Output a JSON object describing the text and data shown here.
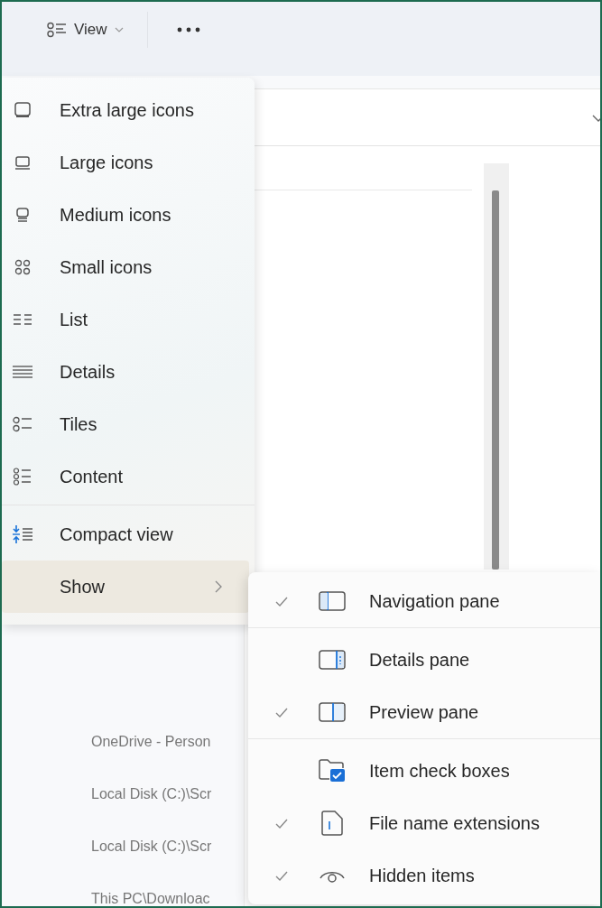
{
  "toolbar": {
    "view_button": {
      "label": "View"
    }
  },
  "background": {
    "locations": [
      "OneDrive - Person",
      "Local Disk (C:)\\Scr",
      "Local Disk (C:)\\Scr",
      "This PC\\Downloac"
    ]
  },
  "view_menu": {
    "items": [
      {
        "label": "Extra large icons",
        "kind": "option"
      },
      {
        "label": "Large icons",
        "kind": "option"
      },
      {
        "label": "Medium icons",
        "kind": "option"
      },
      {
        "label": "Small icons",
        "kind": "option"
      },
      {
        "label": "List",
        "kind": "option"
      },
      {
        "label": "Details",
        "kind": "option"
      },
      {
        "label": "Tiles",
        "kind": "option"
      },
      {
        "label": "Content",
        "kind": "option"
      },
      {
        "label": "Compact view",
        "kind": "toggle"
      },
      {
        "label": "Show",
        "kind": "submenu",
        "expanded": true
      }
    ]
  },
  "show_menu": {
    "items": [
      {
        "label": "Navigation pane",
        "checked": true
      },
      {
        "label": "Details pane",
        "checked": false
      },
      {
        "label": "Preview pane",
        "checked": true
      },
      {
        "label": "Item check boxes",
        "checked": false
      },
      {
        "label": "File name extensions",
        "checked": true
      },
      {
        "label": "Hidden items",
        "checked": true
      }
    ]
  }
}
